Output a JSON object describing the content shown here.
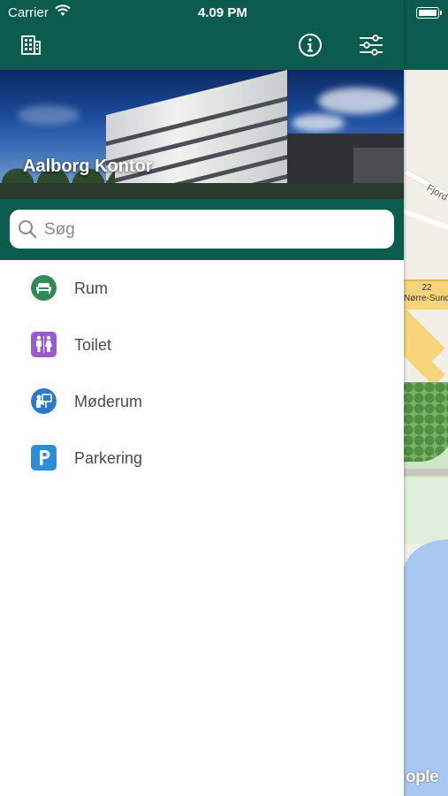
{
  "status_bar": {
    "carrier": "Carrier",
    "time": "4.09 PM"
  },
  "navbar": {
    "left_icon": "building-icon",
    "info_icon": "info-icon",
    "filter_icon": "sliders-icon",
    "background_color": "#0b5b4e"
  },
  "hero": {
    "title": "Aalborg Kontor"
  },
  "search": {
    "placeholder": "Søg",
    "value": ""
  },
  "categories": [
    {
      "label": "Rum",
      "icon": "sofa-icon",
      "color": "#2e8b57"
    },
    {
      "label": "Toilet",
      "icon": "restroom-icon",
      "color": "#9b59d0"
    },
    {
      "label": "Møderum",
      "icon": "meeting-icon",
      "color": "#2f79c9"
    },
    {
      "label": "Parkering",
      "icon": "parking-icon",
      "color": "#2a8fd8"
    }
  ],
  "map": {
    "road_label": "Fjord",
    "route_number": "22",
    "route_name": "Nørre-Sundby",
    "legal_text": "ople"
  }
}
